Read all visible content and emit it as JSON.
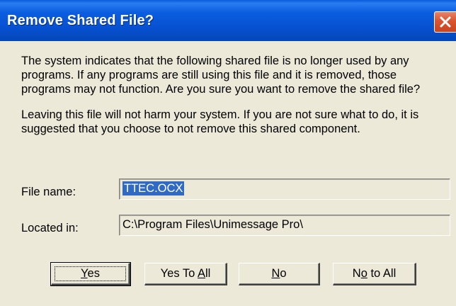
{
  "window": {
    "title": "Remove Shared File?"
  },
  "message": {
    "paragraph1": "The system indicates that the following shared file is no longer used by any programs.  If any programs are still using this file and it is removed, those programs may not function.  Are you sure you want to remove the shared file?",
    "paragraph2": "Leaving this file will not harm your system.  If you are not sure what to do, it is suggested that you choose to not remove this shared component."
  },
  "fields": {
    "file_name_label": "File name:",
    "file_name_value": "TTEC.OCX",
    "located_in_label": "Located in:",
    "located_in_value": "C:\\Program Files\\Unimessage Pro\\"
  },
  "buttons": {
    "yes": {
      "pre": "",
      "key": "Y",
      "post": "es"
    },
    "yes_to_all": {
      "pre": "Yes To ",
      "key": "A",
      "post": "ll"
    },
    "no": {
      "pre": "",
      "key": "N",
      "post": "o"
    },
    "no_to_all": {
      "pre": "N",
      "key": "o",
      "post": " to All"
    }
  },
  "icons": {
    "close": "close-icon"
  },
  "colors": {
    "title_bar": "#0650d0",
    "close_button": "#d9542f",
    "dialog_background": "#ece9d8",
    "selection": "#316ac5"
  }
}
